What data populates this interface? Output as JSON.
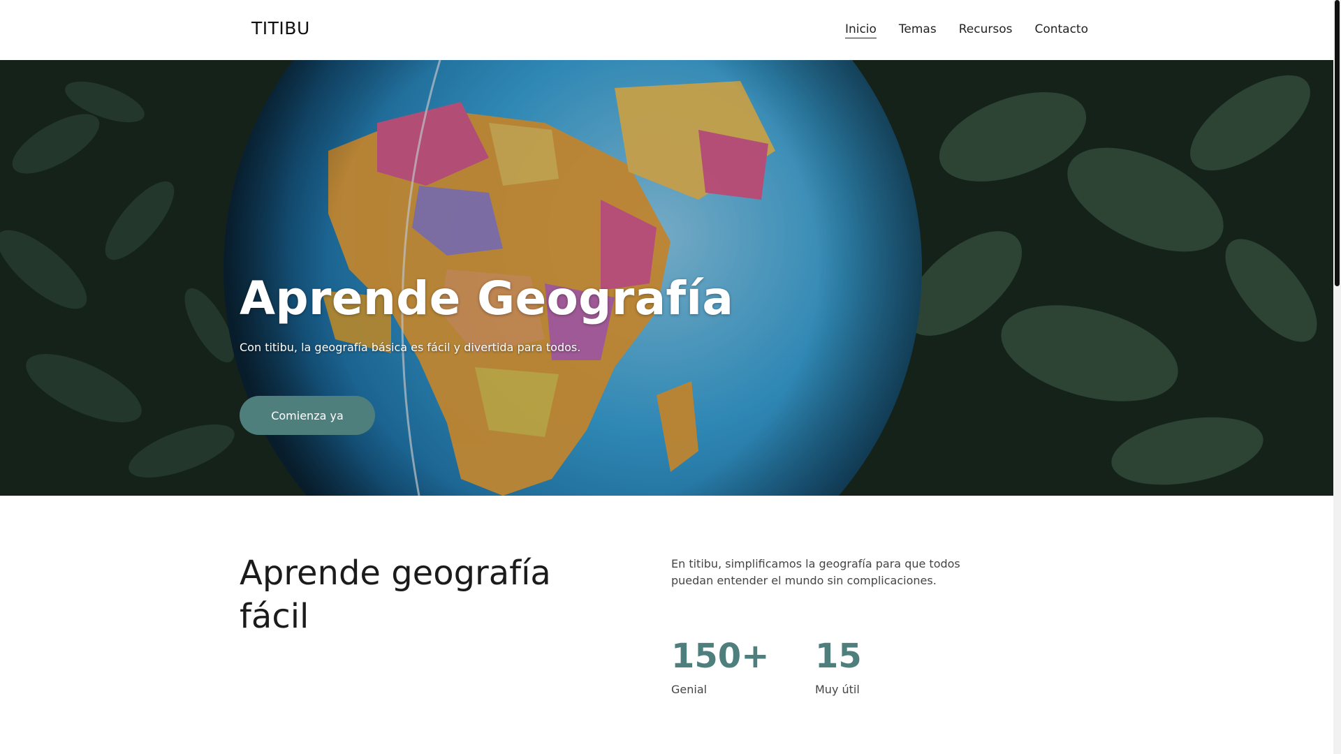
{
  "header": {
    "brand": "TITIBU",
    "nav": [
      {
        "label": "Inicio",
        "active": true
      },
      {
        "label": "Temas"
      },
      {
        "label": "Recursos"
      },
      {
        "label": "Contacto"
      }
    ]
  },
  "hero": {
    "title": "Aprende Geografía",
    "subtitle": "Con titibu, la geografía básica es fácil y divertida para todos.",
    "cta_label": "Comienza ya"
  },
  "about": {
    "title": "Aprende geografía fácil",
    "text": "En titibu, simplificamos la geografía para que todos puedan entender el mundo sin complicaciones.",
    "stats": [
      {
        "value": "150+",
        "label": "Genial"
      },
      {
        "value": "15",
        "label": "Muy útil"
      }
    ]
  },
  "colors": {
    "accent": "#4f7f7d",
    "text": "#222222"
  }
}
